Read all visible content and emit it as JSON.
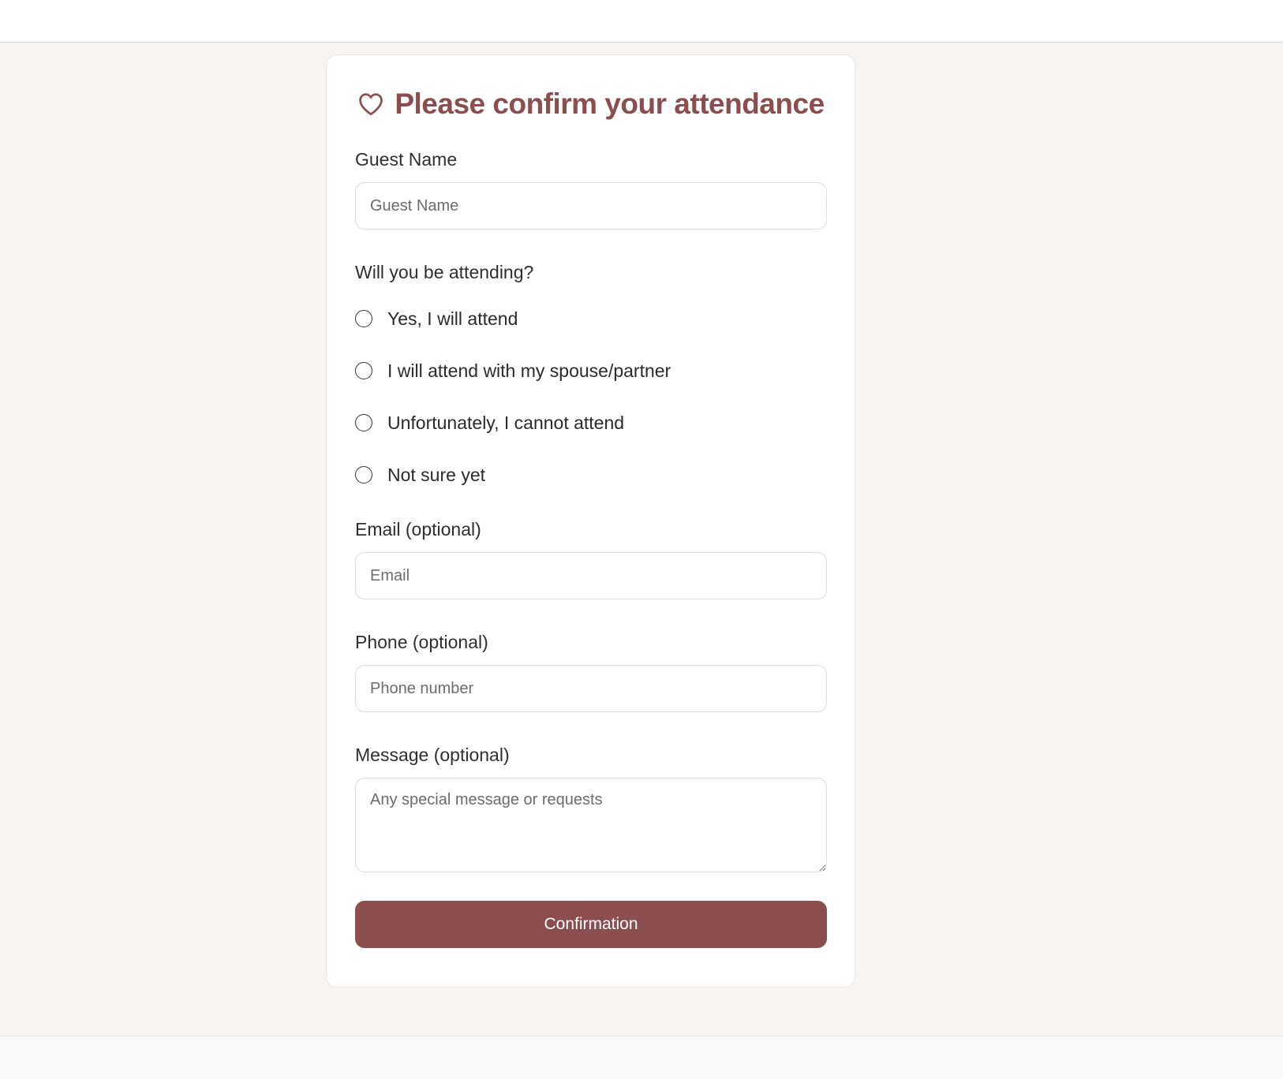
{
  "form": {
    "title": "Please confirm your attendance",
    "title_icon": "heart-outline-icon",
    "accent_color": "#8b4d4d",
    "background_color": "#f7f4f1",
    "guest_name": {
      "label": "Guest Name",
      "placeholder": "Guest Name",
      "value": ""
    },
    "attendance": {
      "question": "Will you be attending?",
      "options": [
        {
          "label": "Yes, I will attend",
          "selected": false
        },
        {
          "label": "I will attend with my spouse/partner",
          "selected": false
        },
        {
          "label": "Unfortunately, I cannot attend",
          "selected": false
        },
        {
          "label": "Not sure yet",
          "selected": false
        }
      ]
    },
    "email": {
      "label": "Email (optional)",
      "placeholder": "Email",
      "value": ""
    },
    "phone": {
      "label": "Phone (optional)",
      "placeholder": "Phone number",
      "value": ""
    },
    "message": {
      "label": "Message (optional)",
      "placeholder": "Any special message or requests",
      "value": ""
    },
    "submit_label": "Confirmation"
  }
}
